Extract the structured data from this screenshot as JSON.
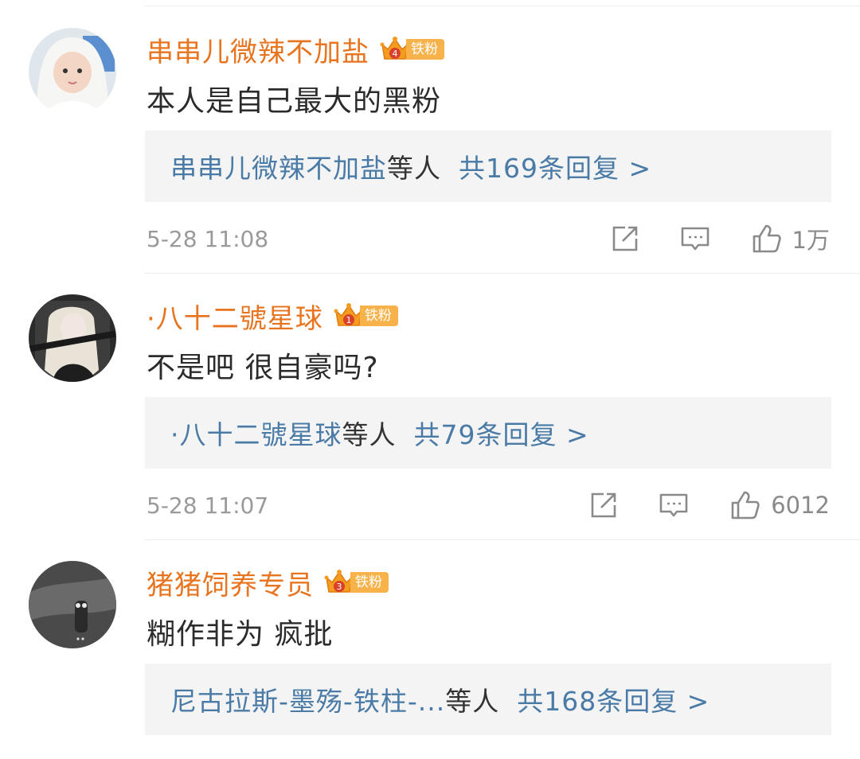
{
  "badge_label": "铁粉",
  "colors": {
    "username": "#e8741f",
    "reply_link": "#4a7aa6",
    "badge": "#f7b24a"
  },
  "icons": {
    "repost": "repost-icon",
    "comment": "comment-icon",
    "like": "like-icon",
    "crown": "crown-icon"
  },
  "comments": [
    {
      "username": "串串儿微辣不加盐",
      "fan_level": "4",
      "text": "本人是自己最大的黑粉",
      "reply_users": "串串儿微辣不加盐",
      "reply_suffix": "等人",
      "reply_count_text": "共169条回复 >",
      "time": "5-28 11:08",
      "likes": "1万"
    },
    {
      "username": "·八十二號星球",
      "fan_level": "1",
      "text": "不是吧 很自豪吗?",
      "reply_users": "·八十二號星球",
      "reply_suffix": "等人",
      "reply_count_text": "共79条回复 >",
      "time": "5-28 11:07",
      "likes": "6012"
    },
    {
      "username": "猪猪饲养专员",
      "fan_level": "3",
      "text": "糊作非为 疯批",
      "reply_users": "尼古拉斯-墨殇-铁柱-...",
      "reply_suffix": "等人",
      "reply_count_text": "共168条回复 >",
      "time": "",
      "likes": ""
    }
  ]
}
